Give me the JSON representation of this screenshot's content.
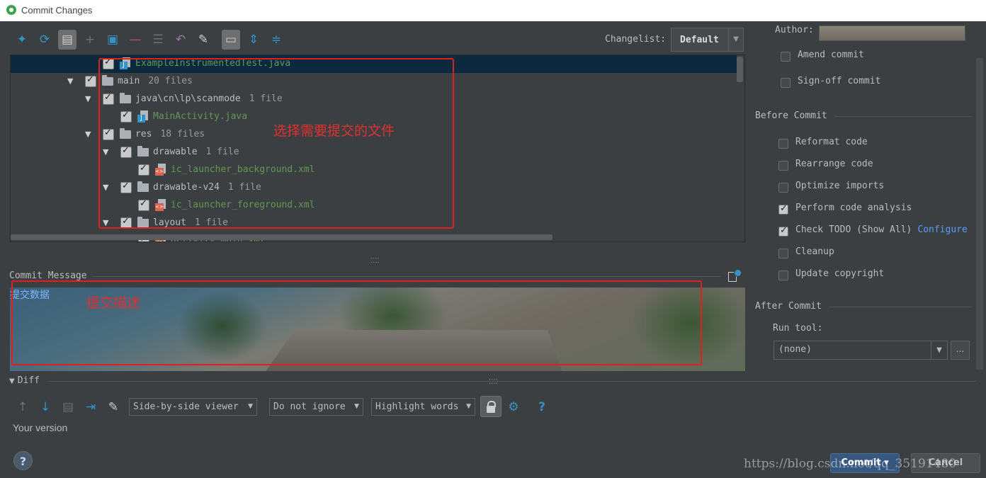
{
  "window": {
    "title": "Commit Changes"
  },
  "toolbar": {
    "icons": [
      "show-diff-icon",
      "refresh-icon",
      "group-by-icon",
      "add-icon",
      "move-to-changelist-icon",
      "remove-icon",
      "shelve-icon",
      "revert-icon",
      "edit-source-icon",
      "show-details-icon",
      "expand-all-icon",
      "collapse-all-icon"
    ],
    "changelist_label": "Changelist:",
    "changelist_value": "Default"
  },
  "tree": {
    "rows": [
      {
        "name": "ExampleInstrumentedTest.java",
        "count": "",
        "type": "java",
        "green": true
      },
      {
        "name": "main",
        "count": "20 files",
        "type": "folder",
        "green": false
      },
      {
        "name": "java\\cn\\lp\\scanmode",
        "count": "1 file",
        "type": "folder",
        "green": false
      },
      {
        "name": "MainActivity.java",
        "count": "",
        "type": "java",
        "green": true
      },
      {
        "name": "res",
        "count": "18 files",
        "type": "folder",
        "green": false
      },
      {
        "name": "drawable",
        "count": "1 file",
        "type": "folder",
        "green": false
      },
      {
        "name": "ic_launcher_background.xml",
        "count": "",
        "type": "xml",
        "green": true
      },
      {
        "name": "drawable-v24",
        "count": "1 file",
        "type": "folder",
        "green": false
      },
      {
        "name": "ic_launcher_foreground.xml",
        "count": "",
        "type": "xml",
        "green": true
      },
      {
        "name": "layout",
        "count": "1 file",
        "type": "folder",
        "green": false
      },
      {
        "name": "activity_main.xml",
        "count": "",
        "type": "xml",
        "green": true
      }
    ]
  },
  "annotations": {
    "select_files": "选择需要提交的文件",
    "commit_description": "提交描述"
  },
  "commit_message": {
    "label": "Commit Message",
    "text": "提交数据"
  },
  "diff": {
    "label": "Diff",
    "viewer": "Side-by-side viewer",
    "ignore": "Do not ignore",
    "highlight": "Highlight words",
    "your_version": "Your version"
  },
  "right": {
    "author_label": "Author:",
    "amend": "Amend commit",
    "signoff": "Sign-off commit",
    "before_commit": "Before Commit",
    "options": [
      {
        "label": "Reformat code",
        "checked": false
      },
      {
        "label": "Rearrange code",
        "checked": false
      },
      {
        "label": "Optimize imports",
        "checked": false
      },
      {
        "label": "Perform code analysis",
        "checked": true
      },
      {
        "label": "Check TODO (Show All)",
        "checked": true,
        "link": "Configure"
      },
      {
        "label": "Cleanup",
        "checked": false
      },
      {
        "label": "Update copyright",
        "checked": false
      }
    ],
    "after_commit": "After Commit",
    "run_tool_label": "Run tool:",
    "run_tool_value": "(none)",
    "browse": "..."
  },
  "buttons": {
    "help": "?",
    "commit": "Commit",
    "cancel": "Cancel"
  },
  "watermark": "https://blog.csdn.net/qq_35191480",
  "colors": {
    "background": "#3c3f41",
    "selection": "#0d293e",
    "file_green": "#629755",
    "annotation_red": "#e03030",
    "link_blue": "#589df6",
    "commit_button": "#365880"
  }
}
